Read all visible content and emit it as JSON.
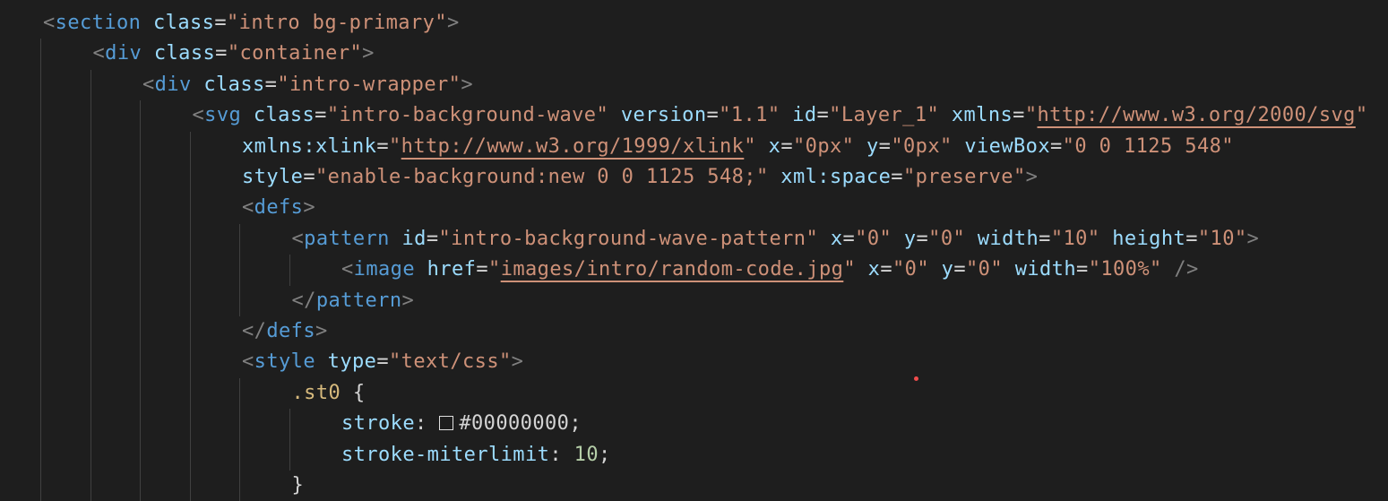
{
  "editor": {
    "language": "html",
    "colors": {
      "background": "#1e1e1e",
      "punctuation": "#808080",
      "tag": "#569cd6",
      "attribute": "#9cdcfe",
      "string": "#ce9178",
      "selector": "#d7ba7d",
      "number": "#b5cea8",
      "plain": "#d4d4d4",
      "marker": "#f14c4c"
    },
    "lines": [
      {
        "indent": 0,
        "tokens": [
          {
            "t": "<",
            "k": "punct"
          },
          {
            "t": "section",
            "k": "tag"
          },
          {
            "t": " ",
            "k": "plain"
          },
          {
            "t": "class",
            "k": "attr"
          },
          {
            "t": "=",
            "k": "plain"
          },
          {
            "t": "\"intro bg-primary\"",
            "k": "str"
          },
          {
            "t": ">",
            "k": "punct"
          }
        ]
      },
      {
        "indent": 1,
        "tokens": [
          {
            "t": "<",
            "k": "punct"
          },
          {
            "t": "div",
            "k": "tag"
          },
          {
            "t": " ",
            "k": "plain"
          },
          {
            "t": "class",
            "k": "attr"
          },
          {
            "t": "=",
            "k": "plain"
          },
          {
            "t": "\"container\"",
            "k": "str"
          },
          {
            "t": ">",
            "k": "punct"
          }
        ]
      },
      {
        "indent": 2,
        "tokens": [
          {
            "t": "<",
            "k": "punct"
          },
          {
            "t": "div",
            "k": "tag"
          },
          {
            "t": " ",
            "k": "plain"
          },
          {
            "t": "class",
            "k": "attr"
          },
          {
            "t": "=",
            "k": "plain"
          },
          {
            "t": "\"intro-wrapper\"",
            "k": "str"
          },
          {
            "t": ">",
            "k": "punct"
          }
        ]
      },
      {
        "indent": 3,
        "tokens": [
          {
            "t": "<",
            "k": "punct"
          },
          {
            "t": "svg",
            "k": "tag"
          },
          {
            "t": " ",
            "k": "plain"
          },
          {
            "t": "class",
            "k": "attr"
          },
          {
            "t": "=",
            "k": "plain"
          },
          {
            "t": "\"intro-background-wave\"",
            "k": "str"
          },
          {
            "t": " ",
            "k": "plain"
          },
          {
            "t": "version",
            "k": "attr"
          },
          {
            "t": "=",
            "k": "plain"
          },
          {
            "t": "\"1.1\"",
            "k": "str"
          },
          {
            "t": " ",
            "k": "plain"
          },
          {
            "t": "id",
            "k": "attr"
          },
          {
            "t": "=",
            "k": "plain"
          },
          {
            "t": "\"Layer_1\"",
            "k": "str"
          },
          {
            "t": " ",
            "k": "plain"
          },
          {
            "t": "xmlns",
            "k": "attr"
          },
          {
            "t": "=",
            "k": "plain"
          },
          {
            "t": "\"",
            "k": "str"
          },
          {
            "t": "http://www.w3.org/2000/svg",
            "k": "link"
          },
          {
            "t": "\"",
            "k": "str"
          }
        ]
      },
      {
        "indent": 4,
        "tokens": [
          {
            "t": "xmlns:xlink",
            "k": "attr"
          },
          {
            "t": "=",
            "k": "plain"
          },
          {
            "t": "\"",
            "k": "str"
          },
          {
            "t": "http://www.w3.org/1999/xlink",
            "k": "link"
          },
          {
            "t": "\"",
            "k": "str"
          },
          {
            "t": " ",
            "k": "plain"
          },
          {
            "t": "x",
            "k": "attr"
          },
          {
            "t": "=",
            "k": "plain"
          },
          {
            "t": "\"0px\"",
            "k": "str"
          },
          {
            "t": " ",
            "k": "plain"
          },
          {
            "t": "y",
            "k": "attr"
          },
          {
            "t": "=",
            "k": "plain"
          },
          {
            "t": "\"0px\"",
            "k": "str"
          },
          {
            "t": " ",
            "k": "plain"
          },
          {
            "t": "viewBox",
            "k": "attr"
          },
          {
            "t": "=",
            "k": "plain"
          },
          {
            "t": "\"0 0 1125 548\"",
            "k": "str"
          }
        ]
      },
      {
        "indent": 4,
        "tokens": [
          {
            "t": "style",
            "k": "attr"
          },
          {
            "t": "=",
            "k": "plain"
          },
          {
            "t": "\"enable-background:new 0 0 1125 548;\"",
            "k": "str"
          },
          {
            "t": " ",
            "k": "plain"
          },
          {
            "t": "xml:space",
            "k": "attr"
          },
          {
            "t": "=",
            "k": "plain"
          },
          {
            "t": "\"preserve\"",
            "k": "str"
          },
          {
            "t": ">",
            "k": "punct"
          }
        ]
      },
      {
        "indent": 4,
        "tokens": [
          {
            "t": "<",
            "k": "punct"
          },
          {
            "t": "defs",
            "k": "tag"
          },
          {
            "t": ">",
            "k": "punct"
          }
        ]
      },
      {
        "indent": 5,
        "tokens": [
          {
            "t": "<",
            "k": "punct"
          },
          {
            "t": "pattern",
            "k": "tag"
          },
          {
            "t": " ",
            "k": "plain"
          },
          {
            "t": "id",
            "k": "attr"
          },
          {
            "t": "=",
            "k": "plain"
          },
          {
            "t": "\"intro-background-wave-pattern\"",
            "k": "str"
          },
          {
            "t": " ",
            "k": "plain"
          },
          {
            "t": "x",
            "k": "attr"
          },
          {
            "t": "=",
            "k": "plain"
          },
          {
            "t": "\"0\"",
            "k": "str"
          },
          {
            "t": " ",
            "k": "plain"
          },
          {
            "t": "y",
            "k": "attr"
          },
          {
            "t": "=",
            "k": "plain"
          },
          {
            "t": "\"0\"",
            "k": "str"
          },
          {
            "t": " ",
            "k": "plain"
          },
          {
            "t": "width",
            "k": "attr"
          },
          {
            "t": "=",
            "k": "plain"
          },
          {
            "t": "\"10\"",
            "k": "str"
          },
          {
            "t": " ",
            "k": "plain"
          },
          {
            "t": "height",
            "k": "attr"
          },
          {
            "t": "=",
            "k": "plain"
          },
          {
            "t": "\"10\"",
            "k": "str"
          },
          {
            "t": ">",
            "k": "punct"
          }
        ]
      },
      {
        "indent": 6,
        "tokens": [
          {
            "t": "<",
            "k": "punct"
          },
          {
            "t": "image",
            "k": "tag"
          },
          {
            "t": " ",
            "k": "plain"
          },
          {
            "t": "href",
            "k": "attr"
          },
          {
            "t": "=",
            "k": "plain"
          },
          {
            "t": "\"",
            "k": "str"
          },
          {
            "t": "images/intro/random-code.jpg",
            "k": "link"
          },
          {
            "t": "\"",
            "k": "str"
          },
          {
            "t": " ",
            "k": "plain"
          },
          {
            "t": "x",
            "k": "attr"
          },
          {
            "t": "=",
            "k": "plain"
          },
          {
            "t": "\"0\"",
            "k": "str"
          },
          {
            "t": " ",
            "k": "plain"
          },
          {
            "t": "y",
            "k": "attr"
          },
          {
            "t": "=",
            "k": "plain"
          },
          {
            "t": "\"0\"",
            "k": "str"
          },
          {
            "t": " ",
            "k": "plain"
          },
          {
            "t": "width",
            "k": "attr"
          },
          {
            "t": "=",
            "k": "plain"
          },
          {
            "t": "\"100%\"",
            "k": "str"
          },
          {
            "t": " ",
            "k": "plain"
          },
          {
            "t": "/>",
            "k": "punct"
          }
        ]
      },
      {
        "indent": 5,
        "tokens": [
          {
            "t": "</",
            "k": "punct"
          },
          {
            "t": "pattern",
            "k": "tag"
          },
          {
            "t": ">",
            "k": "punct"
          }
        ]
      },
      {
        "indent": 4,
        "tokens": [
          {
            "t": "</",
            "k": "punct"
          },
          {
            "t": "defs",
            "k": "tag"
          },
          {
            "t": ">",
            "k": "punct"
          }
        ]
      },
      {
        "indent": 4,
        "tokens": [
          {
            "t": "<",
            "k": "punct"
          },
          {
            "t": "style",
            "k": "tag"
          },
          {
            "t": " ",
            "k": "plain"
          },
          {
            "t": "type",
            "k": "attr"
          },
          {
            "t": "=",
            "k": "plain"
          },
          {
            "t": "\"text/css\"",
            "k": "str"
          },
          {
            "t": ">",
            "k": "punct"
          }
        ]
      },
      {
        "indent": 5,
        "tokens": [
          {
            "t": ".st0",
            "k": "sel"
          },
          {
            "t": " {",
            "k": "plain"
          }
        ]
      },
      {
        "indent": 6,
        "tokens": [
          {
            "t": "stroke",
            "k": "prop"
          },
          {
            "t": ": ",
            "k": "plain"
          },
          {
            "t": "",
            "k": "swatch"
          },
          {
            "t": "#00000000",
            "k": "plain"
          },
          {
            "t": ";",
            "k": "plain"
          }
        ]
      },
      {
        "indent": 6,
        "tokens": [
          {
            "t": "stroke-miterlimit",
            "k": "prop"
          },
          {
            "t": ": ",
            "k": "plain"
          },
          {
            "t": "10",
            "k": "num"
          },
          {
            "t": ";",
            "k": "plain"
          }
        ]
      },
      {
        "indent": 5,
        "tokens": [
          {
            "t": "}",
            "k": "plain"
          }
        ]
      }
    ]
  }
}
